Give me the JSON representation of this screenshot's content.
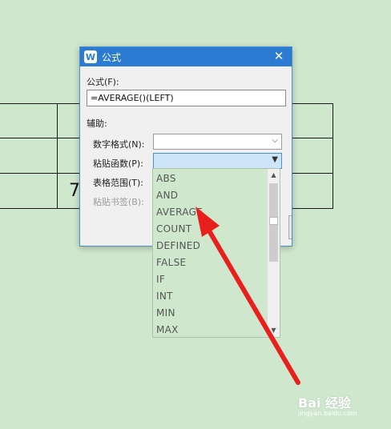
{
  "document": {
    "cell_value": "7"
  },
  "dialog": {
    "app_icon_glyph": "W",
    "title": "公式",
    "close_glyph": "✕",
    "formula_label": "公式(F):",
    "formula_value": "=AVERAGE()(LEFT)",
    "aux_label": "辅助:",
    "number_format_label": "数字格式(N):",
    "paste_function_label": "粘贴函数(P):",
    "table_range_label": "表格范围(T):",
    "paste_bookmark_label": "粘贴书签(B):",
    "combo_arrow": "▼",
    "combo_arrow_light": "⌵"
  },
  "dropdown": {
    "items": [
      "ABS",
      "AND",
      "AVERAGE",
      "COUNT",
      "DEFINED",
      "FALSE",
      "IF",
      "INT",
      "MIN",
      "MAX"
    ],
    "scroll_up": "▲",
    "scroll_down": "▼"
  },
  "watermark": {
    "text": "Bai 经验",
    "sub": "jingyan.baidu.com"
  },
  "colors": {
    "background": "#cfe7cd",
    "titlebar": "#2b7bd3",
    "annotation_arrow": "#e8201d"
  }
}
